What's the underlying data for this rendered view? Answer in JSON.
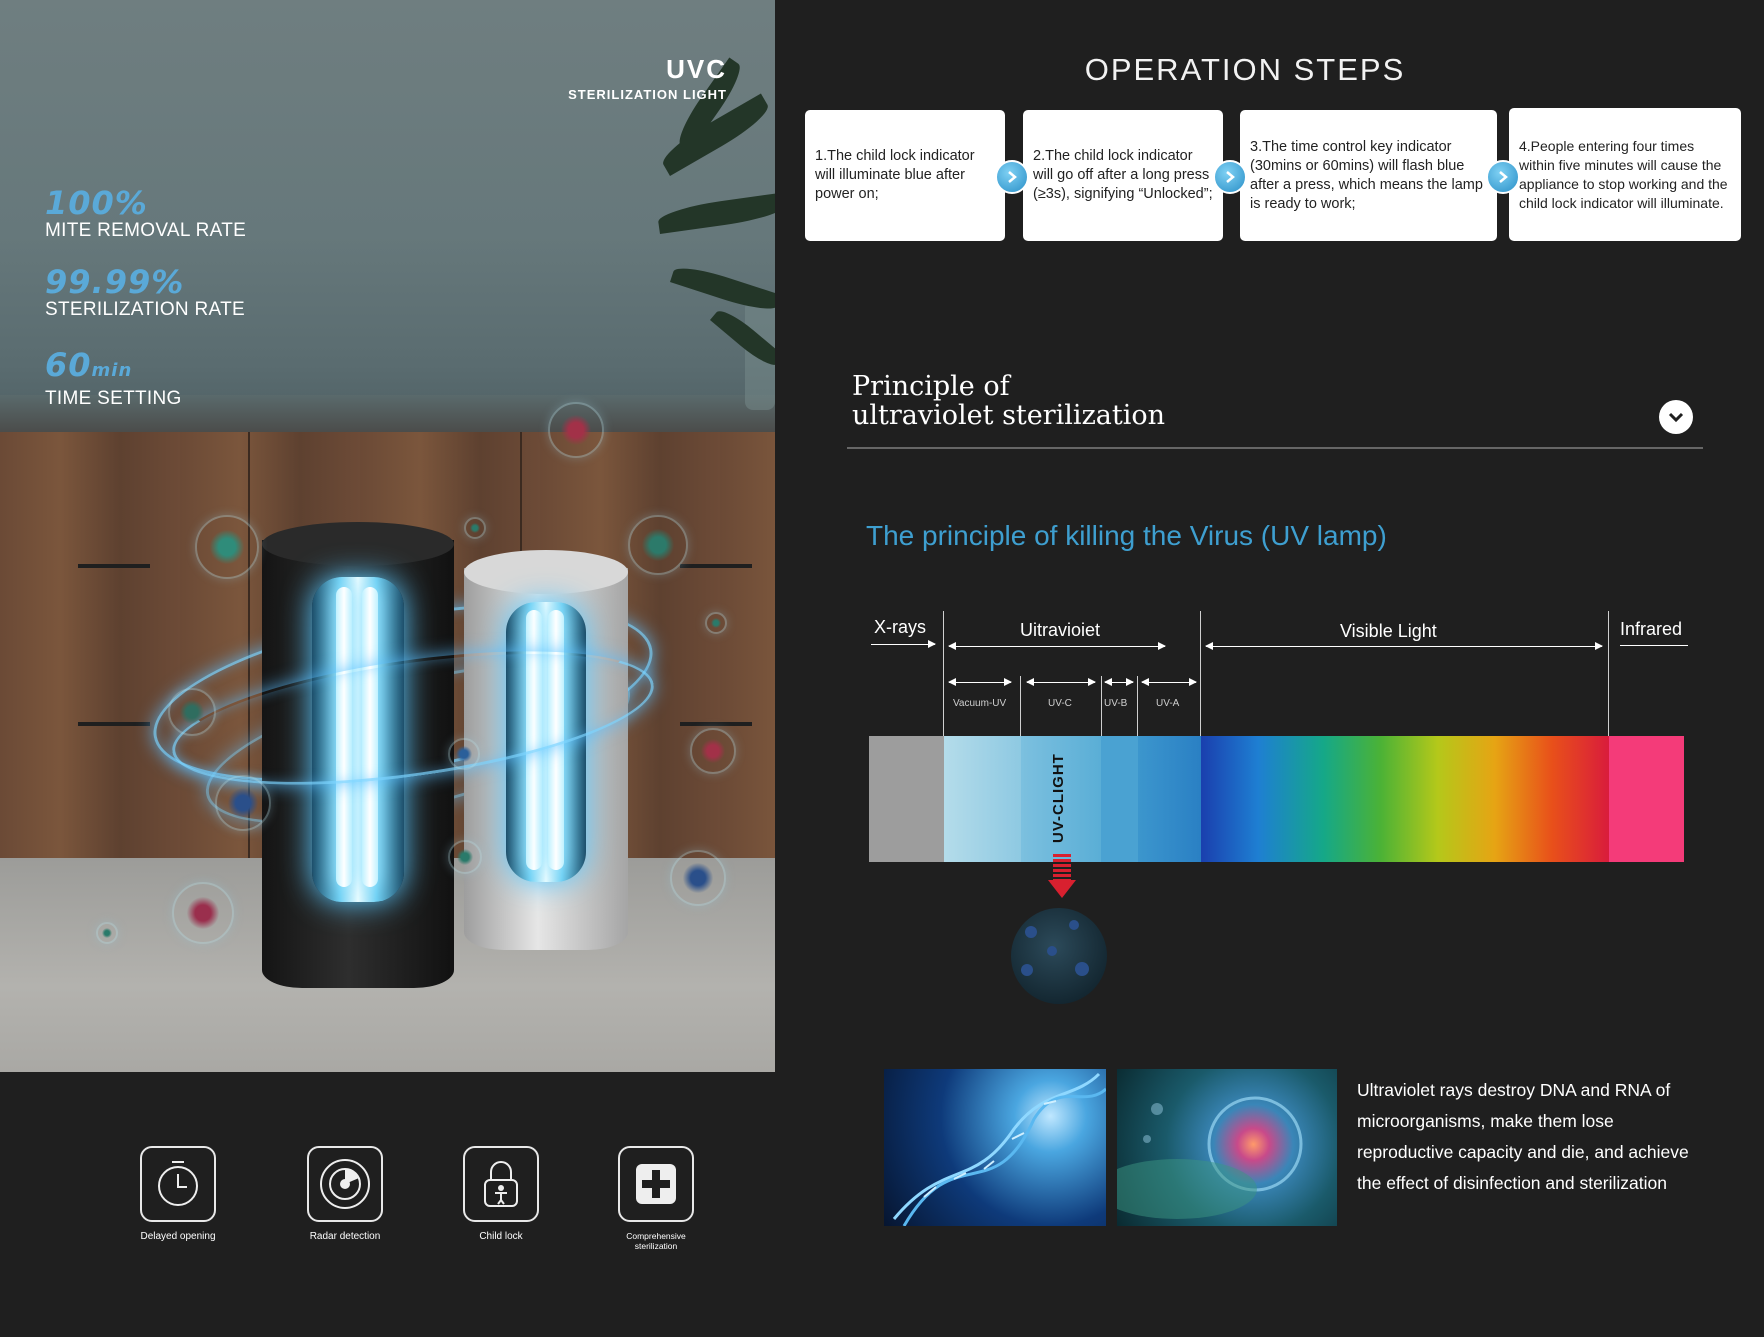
{
  "hero": {
    "uvc_title": "UVC",
    "uvc_subtitle": "STERILIZATION LIGHT",
    "stats": [
      {
        "num": "100%",
        "unit": "",
        "label": "MITE REMOVAL RATE"
      },
      {
        "num": "99.99%",
        "unit": "",
        "label": "STERILIZATION RATE"
      },
      {
        "num": "60",
        "unit": "min",
        "label": "TIME SETTING"
      }
    ]
  },
  "features": [
    {
      "icon": "timer-icon",
      "label": "Delayed opening"
    },
    {
      "icon": "radar-icon",
      "label": "Radar detection"
    },
    {
      "icon": "padlock-child-icon",
      "label": "Child lock"
    },
    {
      "icon": "medical-cross-icon",
      "label": "Comprehensive sterilization"
    }
  ],
  "operation": {
    "title": "OPERATION STEPS",
    "steps": [
      "1.The child lock indicator will illuminate blue after power on;",
      "2.The child lock indicator will go off after a long press (≥3s), signifying “Unlocked”;",
      "3.The time control key indicator (30mins or 60mins) will flash blue after a press, which means the lamp is ready to work;",
      "4.People entering four times within five minutes will cause the appliance to stop working and the child lock indicator will  illuminate."
    ]
  },
  "principle": {
    "title_line1": "Principle of",
    "title_line2": "ultraviolet sterilization",
    "kill_title": "The principle of killing the Virus (UV lamp)",
    "regions": {
      "xrays": "X-rays",
      "uv": "Uitravioiet",
      "visible": "Visible Light",
      "infrared": "Infrared"
    },
    "sub_regions": [
      "Vacuum-UV",
      "UV-C",
      "UV-B",
      "UV-A"
    ],
    "uvc_label": "UV-CLIGHT",
    "description": "Ultraviolet rays destroy DNA and RNA of microorganisms, make them lose reproductive capacity and die, and achieve the effect of disinfection and sterilization"
  },
  "colors": {
    "accent_blue": "#3e9fd0",
    "background": "#1f1f1f",
    "infrared": "#f43b79",
    "xray_gray": "#9d9d9d"
  }
}
